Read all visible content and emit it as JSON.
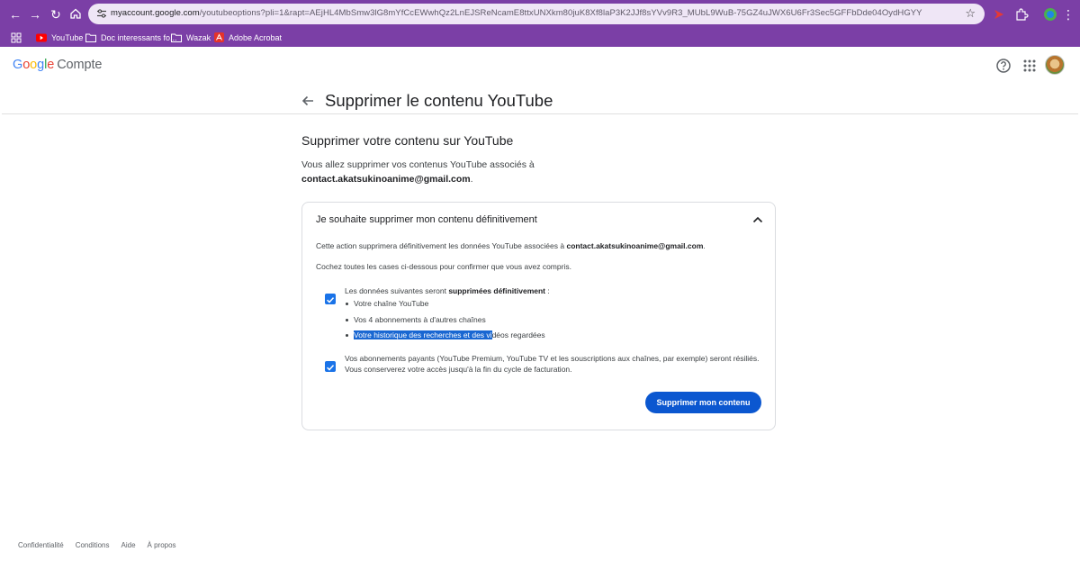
{
  "browser": {
    "url_host": "myaccount.google.com",
    "url_path": "/youtubeoptions?pli=1&rapt=AEjHL4MbSmw3lG8mYfCcEWwhQz2LnEJSReNcamE8ttxUNXkm80juK8Xf8laP3K2JJf8sYVv9R3_MUbL9WuB-75GZ4uJWX6U6Fr3Sec5GFFbDde04OydHGYY",
    "bookmarks": [
      {
        "label": "YouTube",
        "icon": "youtube-icon"
      },
      {
        "label": "Doc interessants fo...",
        "icon": "folder-icon"
      },
      {
        "label": "Wazak",
        "icon": "folder-icon"
      },
      {
        "label": "Adobe Acrobat",
        "icon": "acrobat-icon"
      }
    ]
  },
  "header": {
    "logo_word": [
      "G",
      "o",
      "o",
      "g",
      "l",
      "e"
    ],
    "product": "Compte"
  },
  "page": {
    "title": "Supprimer le contenu YouTube",
    "section_title": "Supprimer votre contenu sur YouTube",
    "intro_text": "Vous allez supprimer vos contenus YouTube associés à",
    "email": "contact.akatsukinoanime@gmail.com",
    "intro_end": "."
  },
  "card": {
    "heading": "Je souhaite supprimer mon contenu définitivement",
    "action_text": "Cette action supprimera définitivement les données YouTube associées à",
    "action_email": "contact.akatsukinoanime@gmail.com",
    "action_end": ".",
    "confirm_text": "Cochez toutes les cases ci-dessous pour confirmer que vous avez compris.",
    "checkbox1": {
      "label_start": "Les données suivantes seront",
      "label_bold": "supprimées définitivement",
      "label_end": " :",
      "checked": true,
      "bullets": [
        "Votre chaîne YouTube",
        "Vos 4 abonnements à d'autres chaînes"
      ],
      "bullet3_selected": "Votre historique des recherches et des vi",
      "bullet3_rest": "déos regardées"
    },
    "checkbox2": {
      "label": "Vos abonnements payants (YouTube Premium, YouTube TV et les souscriptions aux chaînes, par exemple) seront résiliés. Vous conserverez votre accès jusqu'à la fin du cycle de facturation.",
      "checked": true
    },
    "submit_label": "Supprimer mon contenu"
  },
  "footer": [
    "Confidentialité",
    "Conditions",
    "Aide",
    "À propos"
  ],
  "colors": {
    "chrome": "#7b3fa6",
    "primary": "#0b57d0",
    "checkbox": "#1a73e8",
    "selection": "#1967d2"
  }
}
